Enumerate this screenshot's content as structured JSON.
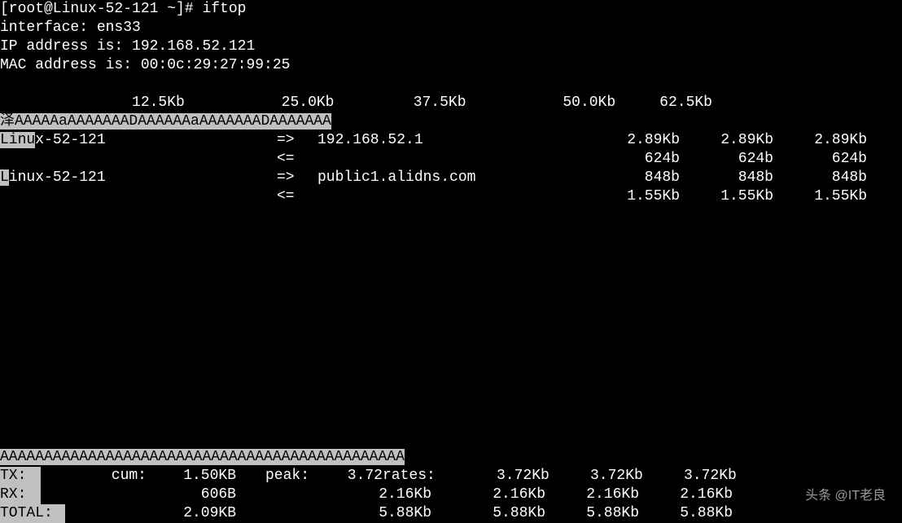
{
  "prompt": {
    "user_host": "[root@Linux-52-121 ~]# ",
    "command": "iftop"
  },
  "header": {
    "interface_label": "interface: ",
    "interface": "ens33",
    "ip_label": "IP address is: ",
    "ip": "192.168.52.121",
    "mac_label": "MAC address is: ",
    "mac": "00:0c:29:27:99:25"
  },
  "scale": {
    "vals": [
      "12.5Kb",
      "25.0Kb",
      "37.5Kb",
      "50.0Kb",
      "62.5Kb"
    ]
  },
  "scale_bar": "泽AAAAAaAAAAAAADAAAAAAaAAAAAAADAAAAAAA",
  "connections": [
    {
      "src": "Linux-52-121",
      "src_hl_prefix": "Linu",
      "arrow_out": "=>",
      "dst": "192.168.52.1",
      "tx": [
        "2.89Kb",
        "2.89Kb",
        "2.89Kb"
      ],
      "arrow_in": "<=",
      "rx": [
        "624b",
        "624b",
        "624b"
      ]
    },
    {
      "src": "Linux-52-121",
      "src_hl_prefix": "L",
      "arrow_out": "=>",
      "dst": "public1.alidns.com",
      "tx": [
        "848b",
        "848b",
        "848b"
      ],
      "arrow_in": "<=",
      "rx": [
        "1.55Kb",
        "1.55Kb",
        "1.55Kb"
      ]
    }
  ],
  "divider": "AAAAAAAAAAAAAAAAAAAAAAAAAAAAAAAAAAAAAAAAAAAAAA",
  "stats": {
    "cum_label": "cum:",
    "peak_label": "peak:",
    "rates_label": "rates:",
    "tx": {
      "label": "TX:",
      "cum": "1.50KB",
      "peak": "3.72",
      "rates": [
        "3.72Kb",
        "3.72Kb",
        "3.72Kb"
      ]
    },
    "rx": {
      "label": "RX:",
      "cum": "606B",
      "peak": "2.16Kb",
      "rates": [
        "2.16Kb",
        "2.16Kb",
        "2.16Kb"
      ]
    },
    "total": {
      "label": "TOTAL:",
      "cum": "2.09KB",
      "peak": "5.88Kb",
      "rates": [
        "5.88Kb",
        "5.88Kb",
        "5.88Kb"
      ]
    }
  },
  "watermark": "头条 @IT老良"
}
